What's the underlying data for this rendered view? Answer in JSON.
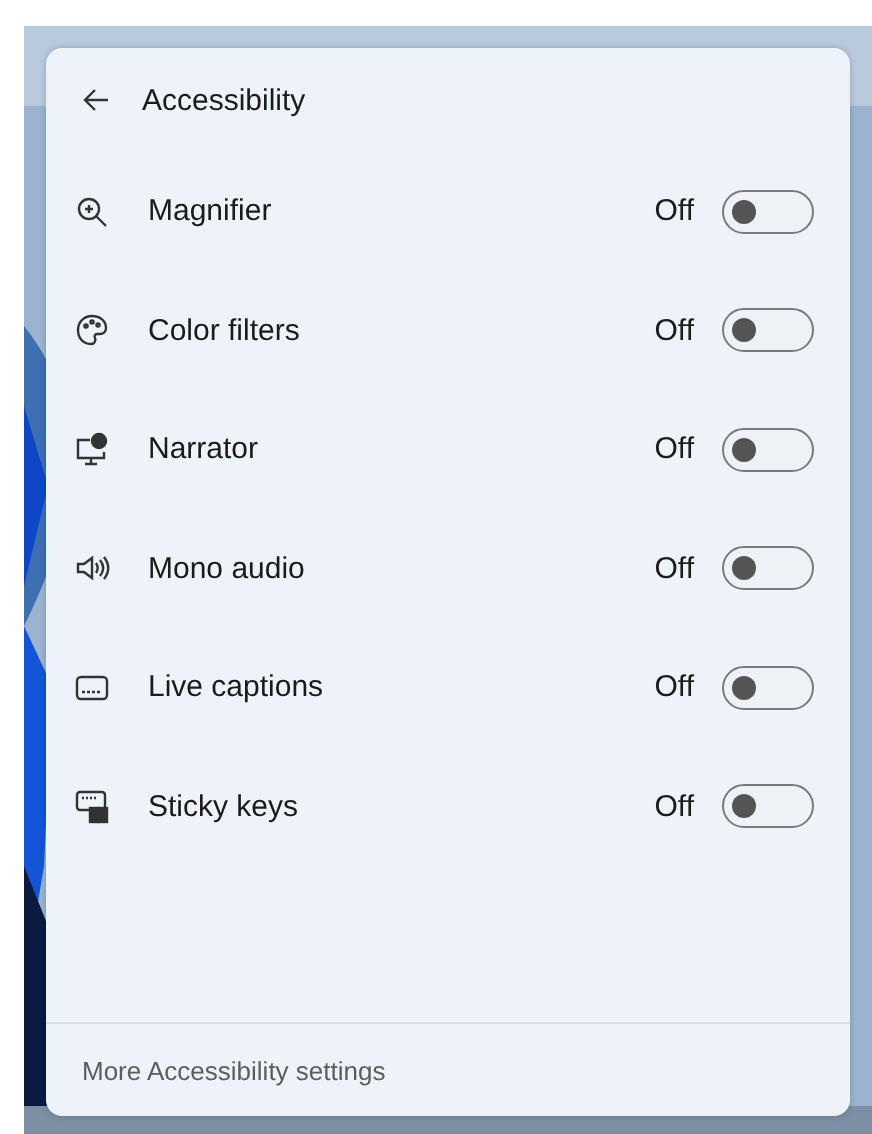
{
  "header": {
    "title": "Accessibility"
  },
  "items": [
    {
      "kind": "magnifier",
      "label": "Magnifier",
      "state": "Off",
      "on": false
    },
    {
      "kind": "palette",
      "label": "Color filters",
      "state": "Off",
      "on": false
    },
    {
      "kind": "narrator",
      "label": "Narrator",
      "state": "Off",
      "on": false
    },
    {
      "kind": "audio",
      "label": "Mono audio",
      "state": "Off",
      "on": false
    },
    {
      "kind": "captions",
      "label": "Live captions",
      "state": "Off",
      "on": false
    },
    {
      "kind": "keyboard",
      "label": "Sticky keys",
      "state": "Off",
      "on": false
    }
  ],
  "footer": {
    "link": "More Accessibility settings"
  }
}
